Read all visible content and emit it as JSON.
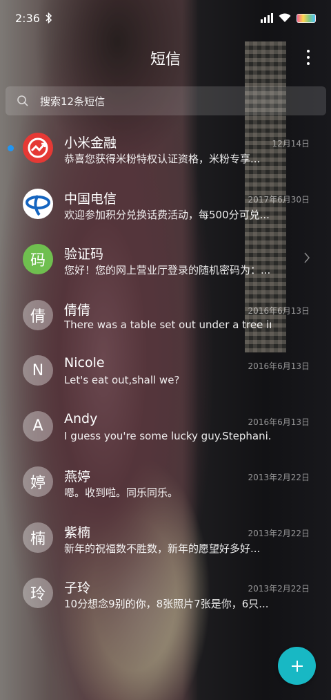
{
  "status_bar": {
    "time": "2:36"
  },
  "header": {
    "title": "短信"
  },
  "search": {
    "placeholder": "搜索12条短信"
  },
  "conversations": [
    {
      "name": "小米金融",
      "date": "12月14日",
      "preview": "恭喜您获得米粉特权认证资格，米粉专享...",
      "unread": true,
      "avatar": "mifinance-logo"
    },
    {
      "name": "中国电信",
      "date": "2017年6月30日",
      "preview": "欢迎参加积分兑换话费活动，每500分可兑...",
      "avatar": "china-telecom-logo"
    },
    {
      "name": "验证码",
      "date": "",
      "preview": "您好！您的网上营业厅登录的随机密码为：...",
      "avatar_text": "码",
      "avatar_color": "#6fbf4f"
    },
    {
      "name": "倩倩",
      "date": "2016年6月13日",
      "preview": "There was a table set out under a tree in...",
      "avatar_text": "倩"
    },
    {
      "name": "Nicole",
      "date": "2016年6月13日",
      "preview": "Let's eat out,shall we?",
      "avatar_text": "N"
    },
    {
      "name": "Andy",
      "date": "2016年6月13日",
      "preview": "I guess you're some lucky guy.Stephani...",
      "avatar_text": "A"
    },
    {
      "name": "燕婷",
      "date": "2013年2月22日",
      "preview": "嗯。收到啦。同乐同乐。",
      "avatar_text": "婷"
    },
    {
      "name": "紫楠",
      "date": "2013年2月22日",
      "preview": "新年的祝福数不胜数，新年的愿望好多好...",
      "avatar_text": "楠"
    },
    {
      "name": "子玲",
      "date": "2013年2月22日",
      "preview": "10分想念9别的你，8张照片7张是你，6只...",
      "avatar_text": "玲"
    }
  ],
  "colors": {
    "fab": "#18b8c4",
    "unread_dot": "#2196f3"
  }
}
